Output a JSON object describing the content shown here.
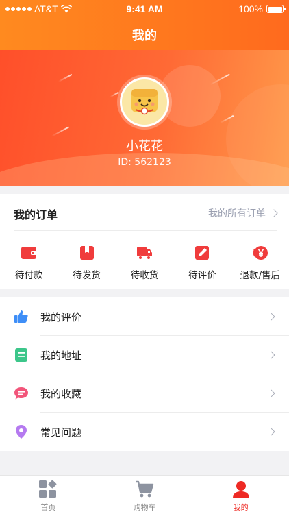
{
  "status_bar": {
    "carrier": "AT&T",
    "time": "9:41 AM",
    "battery": "100%"
  },
  "nav": {
    "title": "我的"
  },
  "profile": {
    "name": "小花花",
    "id": "ID: 562123"
  },
  "orders": {
    "title": "我的订单",
    "all_link": "我的所有订单",
    "items": [
      {
        "label": "待付款",
        "icon": "wallet-icon"
      },
      {
        "label": "待发货",
        "icon": "package-icon"
      },
      {
        "label": "待收货",
        "icon": "truck-icon"
      },
      {
        "label": "待评价",
        "icon": "edit-icon"
      },
      {
        "label": "退款/售后",
        "icon": "refund-icon"
      }
    ]
  },
  "menu": [
    {
      "label": "我的评价",
      "icon": "thumbs-up-icon",
      "color": "#3e8ef7"
    },
    {
      "label": "我的地址",
      "icon": "document-icon",
      "color": "#3cc68a"
    },
    {
      "label": "我的收藏",
      "icon": "chat-bubble-icon",
      "color": "#f2557a"
    },
    {
      "label": "常见问题",
      "icon": "location-pin-icon",
      "color": "#b57af0"
    }
  ],
  "tabbar": {
    "active": "我的",
    "tabs": [
      {
        "label": "首页",
        "icon": "grid-icon"
      },
      {
        "label": "购物车",
        "icon": "cart-icon"
      },
      {
        "label": "我的",
        "icon": "user-icon"
      }
    ]
  },
  "colors": {
    "accent": "#ff6a1e",
    "active_tab": "#ee2a24",
    "icon_red": "#f03c3c"
  }
}
